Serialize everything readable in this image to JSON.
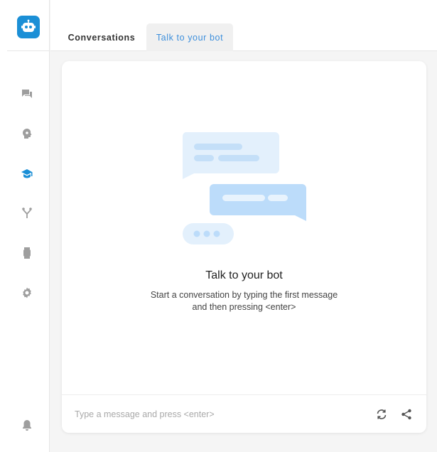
{
  "app": {
    "logo_icon": "robot-icon",
    "accent_color": "#1b8fd6"
  },
  "sidebar": {
    "items": [
      {
        "icon": "conversations-icon",
        "color": "#9e9e9e"
      },
      {
        "icon": "brain-icon",
        "color": "#9e9e9e"
      },
      {
        "icon": "graduation-cap-icon",
        "color": "#1b8fd6",
        "active": true
      },
      {
        "icon": "branch-icon",
        "color": "#9e9e9e"
      },
      {
        "icon": "watch-icon",
        "color": "#9e9e9e"
      },
      {
        "icon": "gear-icon",
        "color": "#9e9e9e"
      }
    ],
    "bottom_icon": "bell-icon"
  },
  "tabs": {
    "conversations": "Conversations",
    "talk": "Talk to your bot"
  },
  "chat": {
    "empty_title": "Talk to your bot",
    "empty_line1": "Start a conversation by typing the first message",
    "empty_line2": "and then pressing <enter>"
  },
  "composer": {
    "placeholder": "Type a message and press <enter>",
    "value": "",
    "restart_icon": "restart-icon",
    "share_icon": "share-icon"
  }
}
